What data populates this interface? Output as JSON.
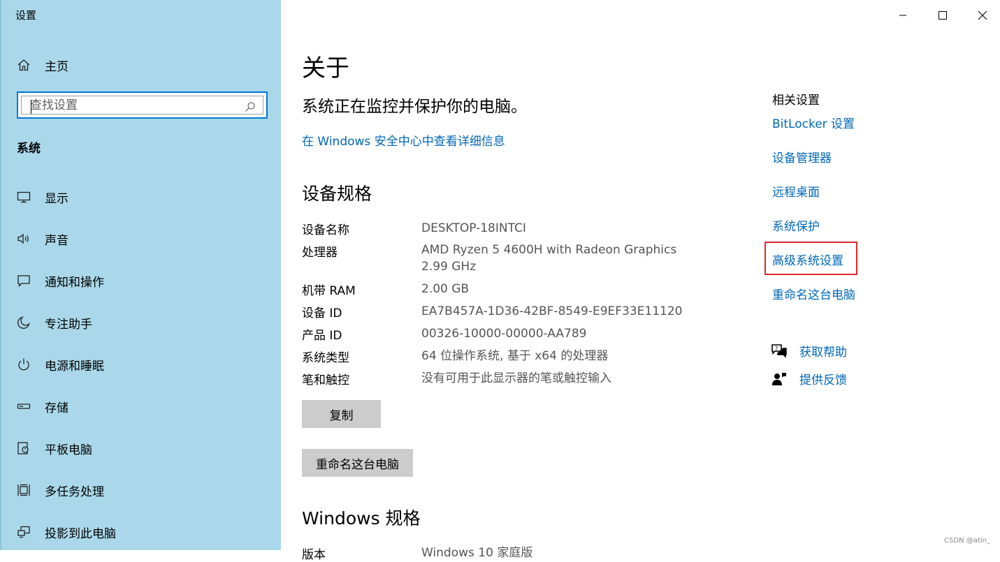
{
  "app": {
    "title": "设置"
  },
  "window_controls": {
    "minimize": "—",
    "maximize": "□",
    "close": "✕"
  },
  "sidebar": {
    "home_label": "主页",
    "search_placeholder": "查找设置",
    "section_title": "系统",
    "items": [
      {
        "label": "显示",
        "icon": "monitor-icon"
      },
      {
        "label": "声音",
        "icon": "speaker-icon"
      },
      {
        "label": "通知和操作",
        "icon": "notification-icon"
      },
      {
        "label": "专注助手",
        "icon": "moon-icon"
      },
      {
        "label": "电源和睡眠",
        "icon": "power-icon"
      },
      {
        "label": "存储",
        "icon": "storage-icon"
      },
      {
        "label": "平板电脑",
        "icon": "tablet-icon"
      },
      {
        "label": "多任务处理",
        "icon": "multitask-icon"
      },
      {
        "label": "投影到此电脑",
        "icon": "project-icon"
      }
    ]
  },
  "main": {
    "title": "关于",
    "protect_text": "系统正在监控并保护你的电脑。",
    "security_link": "在 Windows 安全中心中查看详细信息",
    "device_spec_title": "设备规格",
    "specs": [
      {
        "label": "设备名称",
        "value": "DESKTOP-18INTCI"
      },
      {
        "label": "处理器",
        "value": "AMD Ryzen 5 4600H with Radeon Graphics",
        "value2": "2.99 GHz"
      },
      {
        "label": "机带 RAM",
        "value": "2.00 GB"
      },
      {
        "label": "设备 ID",
        "value": "EA7B457A-1D36-42BF-8549-E9EF33E11120"
      },
      {
        "label": "产品 ID",
        "value": "00326-10000-00000-AA789"
      },
      {
        "label": "系统类型",
        "value": "64 位操作系统, 基于 x64 的处理器"
      },
      {
        "label": "笔和触控",
        "value": "没有可用于此显示器的笔或触控输入"
      }
    ],
    "copy_button": "复制",
    "rename_button": "重命名这台电脑",
    "windows_spec_title": "Windows 规格",
    "partial_label": "版本",
    "partial_value": "Windows 10 家庭版"
  },
  "related": {
    "title": "相关设置",
    "links": [
      "BitLocker 设置",
      "设备管理器",
      "远程桌面",
      "系统保护",
      "高级系统设置",
      "重命名这台电脑"
    ],
    "help": "获取帮助",
    "feedback": "提供反馈"
  },
  "watermark": "CSDN @atin_",
  "colors": {
    "sidebar_bg": "#aad8ea",
    "link": "#0067b8",
    "accent": "#0078d7",
    "highlight": "#e0262a"
  }
}
